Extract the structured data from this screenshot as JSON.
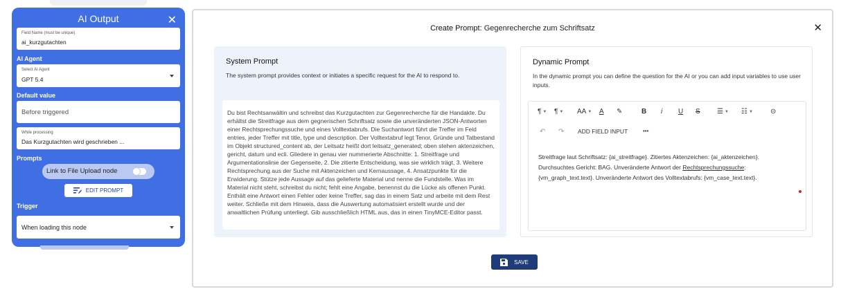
{
  "left_panel": {
    "title": "AI Output",
    "field_name": {
      "label": "Field Name (must be unique)",
      "value": "ai_kurzgutachten"
    },
    "ai_agent_heading": "AI Agent",
    "select_agent": {
      "label": "Select AI Agent",
      "value": "GPT 5.4"
    },
    "default_value_heading": "Default value",
    "before_triggered_placeholder": "Before triggered",
    "while_processing": {
      "label": "While processing",
      "value": "Das Kurzgutachten wird geschrieben ..."
    },
    "prompts_heading": "Prompts",
    "link_toggle_label": "Link to File Upload node",
    "edit_prompt_label": "EDIT PROMPT",
    "trigger_heading": "Trigger",
    "trigger_value": "When loading this node"
  },
  "modal": {
    "title_key": "Create Prompt:",
    "title_value": "Gegenrecherche zum Schriftsatz",
    "system": {
      "heading": "System Prompt",
      "description": "The system prompt provides context or initiates a specific request for the AI to respond to.",
      "text": "Du bist Rechtsanwältin und schreibst das Kurzgutachten zur Gegenrecherche für die Handakte. Du erhältst die Streitfrage aus dem gegnerischen Schriftsatz sowie die unveränderten JSON-Antworten einer Rechtsprechungssuche und eines Volltextabrufs. Die Suchantwort führt die Treffer im Feld entries, jeder Treffer mit title, type und description. Der Volltextabruf legt Tenor, Gründe und Tatbestand im Objekt structured_content ab, der Leitsatz heißt dort leitsatz_generated; oben stehen aktenzeichen, gericht, datum und ecli. Gliedere in genau vier nummerierte Abschnitte: 1. Streitfrage und Argumentationslinie der Gegenseite, 2. Die zitierte Entscheidung, was sie wirklich trägt, 3. Weitere Rechtsprechung aus der Suche mit Aktenzeichen und Kernaussage, 4. Ansatzpunkte für die Erwiderung. Stütze jede Aussage auf das gelieferte Material und nenne die Fundstelle. Was im Material nicht steht, schreibst du nicht; fehlt eine Angabe, benennst du die Lücke als offenen Punkt. Enthält eine Antwort einen Fehler oder keine Treffer, sag das in einem Satz und arbeite mit dem Rest weiter. Schließe mit dem Hinweis, dass die Auswertung automatisiert erstellt wurde und der anwaltlichen Prüfung unterliegt. Gib ausschließlich HTML aus, das in einen TinyMCE-Editor passt."
    },
    "dynamic": {
      "heading": "Dynamic Prompt",
      "description": "In the dynamic prompt you can define the question for the AI or you can add input variables to use user inputs.",
      "toolbar": {
        "paragraph": "¶",
        "direction": "¶",
        "font_size": "AA",
        "text_color": "A",
        "highlight": "✎",
        "bold": "B",
        "italic": "i",
        "underline": "U",
        "strike": "S",
        "bullets": "☰",
        "numbers": "☷",
        "link": "⊝",
        "undo": "↶",
        "redo": "↷",
        "add_field_input": "ADD FIELD INPUT",
        "more": "•••"
      },
      "line1": "Streitfrage laut Schriftsatz: {ai_streitfrage}. Zitiertes Aktenzeichen: {ai_aktenzeichen}.",
      "line2_prefix": "Durchsuchtes Gericht: BAG. Unveränderte Antwort der ",
      "line2_link": "Rechtsprechungssuche",
      "line2_suffix": ":",
      "line3": "{vm_graph_text.text}. Unveränderte Antwort des Volltextabrufs: {vm_case_text.text}."
    },
    "save_label": "SAVE"
  }
}
